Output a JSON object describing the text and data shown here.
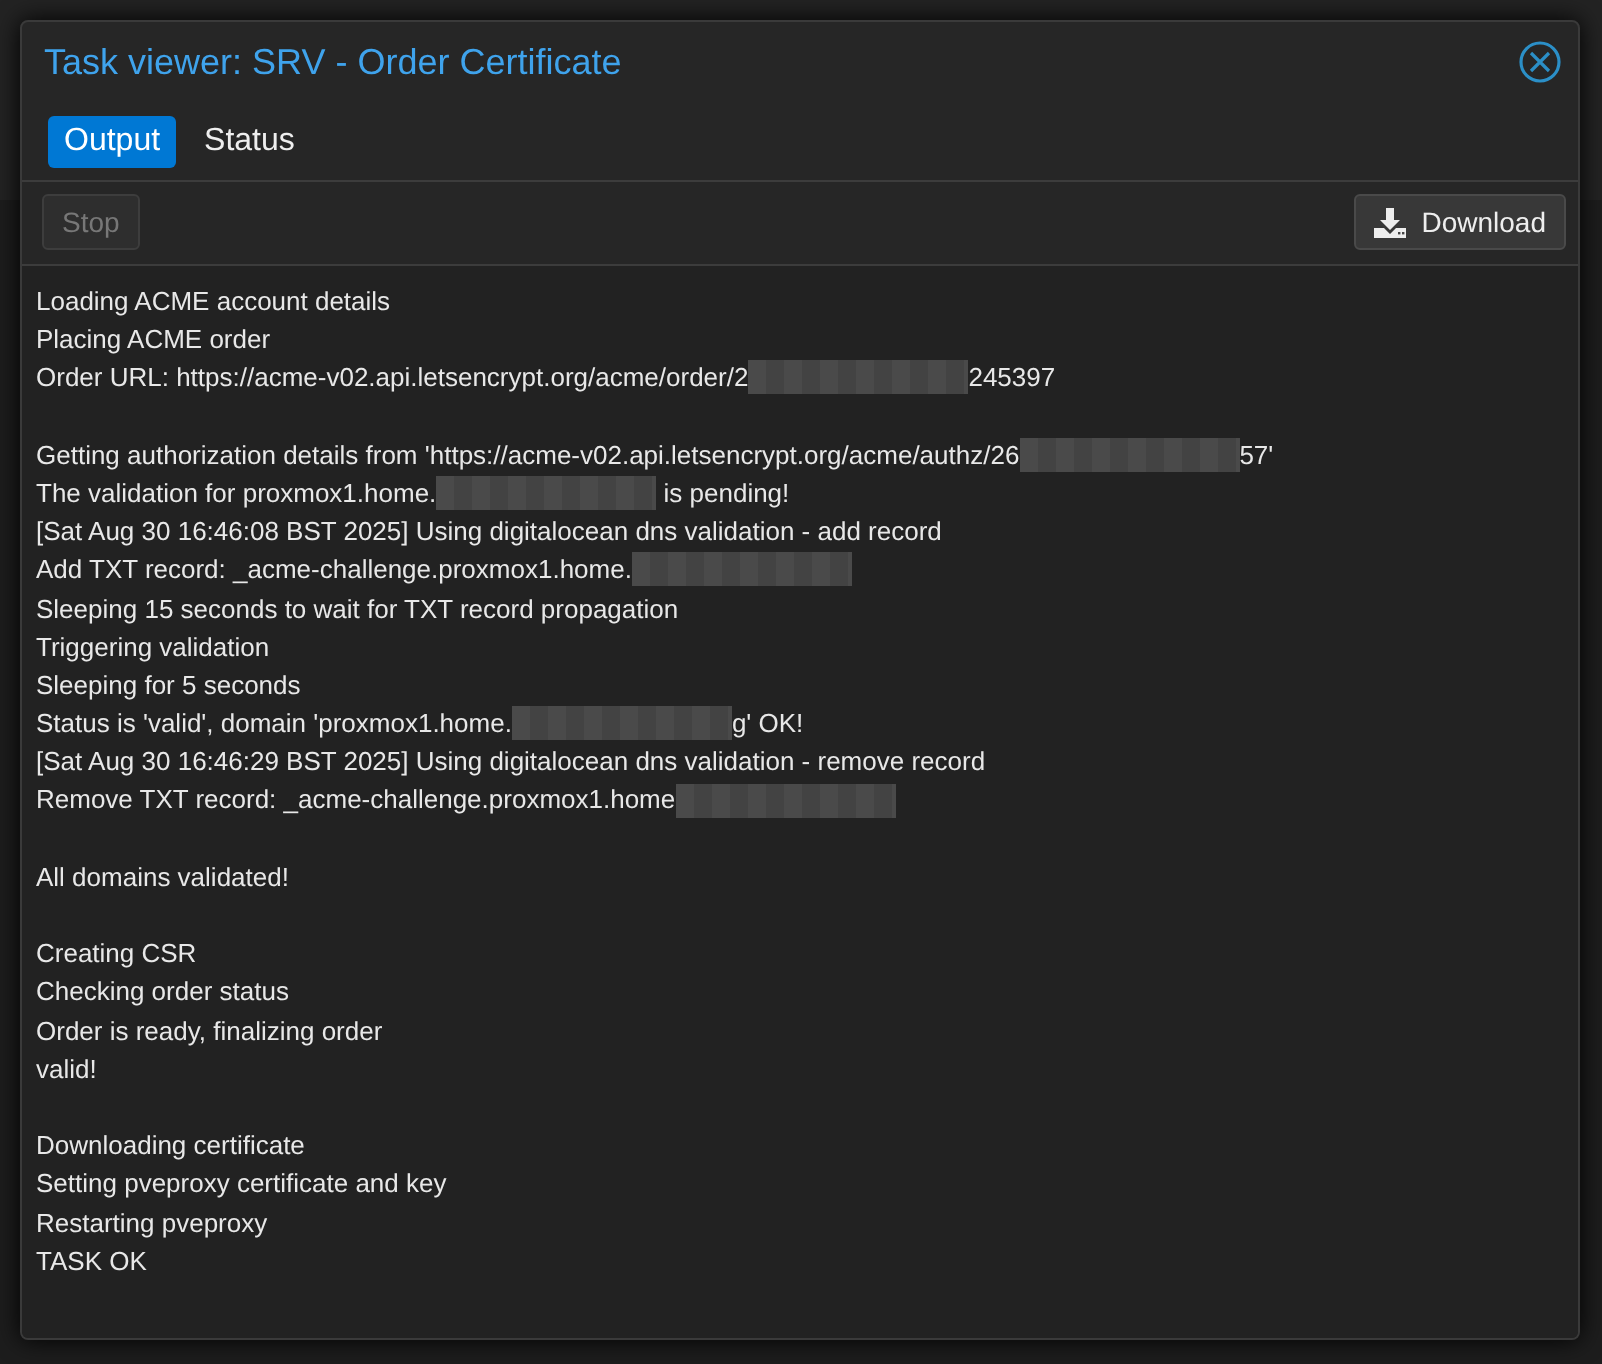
{
  "window": {
    "title": "Task viewer: SRV - Order Certificate"
  },
  "tabs": [
    {
      "label": "Output",
      "selected": true
    },
    {
      "label": "Status",
      "selected": false
    }
  ],
  "toolbar": {
    "stop": {
      "label": "Stop",
      "disabled": true
    },
    "download": {
      "label": "Download"
    }
  },
  "log": [
    {
      "kind": "line",
      "segments": [
        {
          "kind": "text",
          "text": "Loading ACME account details"
        }
      ]
    },
    {
      "kind": "line",
      "segments": [
        {
          "kind": "text",
          "text": "Placing ACME order"
        }
      ]
    },
    {
      "kind": "line",
      "segments": [
        {
          "kind": "text",
          "text": "Order URL: https://acme-v02.api.letsencrypt.org/acme/order/2"
        },
        {
          "kind": "redacted"
        },
        {
          "kind": "text",
          "text": "245397"
        }
      ]
    },
    {
      "kind": "blank"
    },
    {
      "kind": "line",
      "segments": [
        {
          "kind": "text",
          "text": "Getting authorization details from 'https://acme-v02.api.letsencrypt.org/acme/authz/26"
        },
        {
          "kind": "redacted"
        },
        {
          "kind": "text",
          "text": "57'"
        }
      ]
    },
    {
      "kind": "line",
      "segments": [
        {
          "kind": "text",
          "text": "The validation for proxmox1.home."
        },
        {
          "kind": "redacted"
        },
        {
          "kind": "text",
          "text": " is pending!"
        }
      ]
    },
    {
      "kind": "line",
      "segments": [
        {
          "kind": "text",
          "text": "[Sat Aug 30 16:46:08 BST 2025] Using digitalocean dns validation - add record"
        }
      ]
    },
    {
      "kind": "line",
      "segments": [
        {
          "kind": "text",
          "text": "Add TXT record: _acme-challenge.proxmox1.home."
        },
        {
          "kind": "redacted"
        }
      ]
    },
    {
      "kind": "line",
      "segments": [
        {
          "kind": "text",
          "text": "Sleeping 15 seconds to wait for TXT record propagation"
        }
      ]
    },
    {
      "kind": "line",
      "segments": [
        {
          "kind": "text",
          "text": "Triggering validation"
        }
      ]
    },
    {
      "kind": "line",
      "segments": [
        {
          "kind": "text",
          "text": "Sleeping for 5 seconds"
        }
      ]
    },
    {
      "kind": "line",
      "segments": [
        {
          "kind": "text",
          "text": "Status is 'valid', domain 'proxmox1.home."
        },
        {
          "kind": "redacted"
        },
        {
          "kind": "text",
          "text": "g' OK!"
        }
      ]
    },
    {
      "kind": "line",
      "segments": [
        {
          "kind": "text",
          "text": "[Sat Aug 30 16:46:29 BST 2025] Using digitalocean dns validation - remove record"
        }
      ]
    },
    {
      "kind": "line",
      "segments": [
        {
          "kind": "text",
          "text": "Remove TXT record: _acme-challenge.proxmox1.home"
        },
        {
          "kind": "redacted"
        }
      ]
    },
    {
      "kind": "blank"
    },
    {
      "kind": "line",
      "segments": [
        {
          "kind": "text",
          "text": "All domains validated!"
        }
      ]
    },
    {
      "kind": "blank"
    },
    {
      "kind": "line",
      "segments": [
        {
          "kind": "text",
          "text": "Creating CSR"
        }
      ]
    },
    {
      "kind": "line",
      "segments": [
        {
          "kind": "text",
          "text": "Checking order status"
        }
      ]
    },
    {
      "kind": "line",
      "segments": [
        {
          "kind": "text",
          "text": "Order is ready, finalizing order"
        }
      ]
    },
    {
      "kind": "line",
      "segments": [
        {
          "kind": "text",
          "text": "valid!"
        }
      ]
    },
    {
      "kind": "blank"
    },
    {
      "kind": "line",
      "segments": [
        {
          "kind": "text",
          "text": "Downloading certificate"
        }
      ]
    },
    {
      "kind": "line",
      "segments": [
        {
          "kind": "text",
          "text": "Setting pveproxy certificate and key"
        }
      ]
    },
    {
      "kind": "line",
      "segments": [
        {
          "kind": "text",
          "text": "Restarting pveproxy"
        }
      ]
    },
    {
      "kind": "line",
      "segments": [
        {
          "kind": "text",
          "text": "TASK OK"
        }
      ]
    }
  ]
}
